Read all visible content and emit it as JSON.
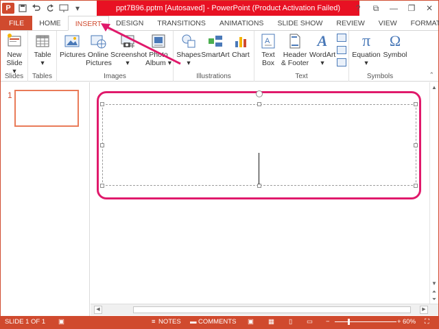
{
  "window": {
    "title": "ppt7B96.pptm [Autosaved] - PowerPoint (Product Activation Failed)",
    "logo_letter": "P",
    "controls": [
      "?",
      "⧉",
      "—",
      "❐",
      "✕"
    ]
  },
  "qat": [
    "save-icon",
    "undo-icon",
    "redo-icon",
    "slideshow-icon",
    "customize-icon"
  ],
  "tabs": [
    "FILE",
    "HOME",
    "INSERT",
    "DESIGN",
    "TRANSITIONS",
    "ANIMATIONS",
    "SLIDE SHOW",
    "REVIEW",
    "VIEW",
    "FORMAT"
  ],
  "active_tab": "INSERT",
  "ribbon": {
    "groups": {
      "slides": "Slides",
      "tables": "Tables",
      "images": "Images",
      "illustrations": "Illustrations",
      "text": "Text",
      "symbols": "Symbols"
    },
    "buttons": {
      "new_slide_1": "New",
      "new_slide_2": "Slide ▾",
      "table_1": "Table",
      "table_2": "▾",
      "pictures": "Pictures",
      "online_pictures_1": "Online",
      "online_pictures_2": "Pictures",
      "screenshot_1": "Screenshot",
      "screenshot_2": "▾",
      "photo_album_1": "Photo",
      "photo_album_2": "Album ▾",
      "shapes_1": "Shapes",
      "shapes_2": "▾",
      "smartart": "SmartArt",
      "chart": "Chart",
      "text_box_1": "Text",
      "text_box_2": "Box",
      "header_footer_1": "Header",
      "header_footer_2": "& Footer",
      "wordart_1": "WordArt",
      "wordart_2": "▾",
      "equation_1": "Equation",
      "equation_2": "▾",
      "symbol": "Symbol"
    },
    "symbol_glyphs": {
      "pi": "π",
      "omega": "Ω",
      "wordart": "A"
    }
  },
  "slides_pane": {
    "slide_number": "1"
  },
  "status": {
    "slide_info": "SLIDE 1 OF 1",
    "notes": "NOTES",
    "comments": "COMMENTS",
    "zoom_minus": "−",
    "zoom_plus": "+",
    "zoom": "60%"
  },
  "colors": {
    "accent": "#d04a2e",
    "title_bg": "#e81123",
    "highlight": "#e0196b"
  }
}
